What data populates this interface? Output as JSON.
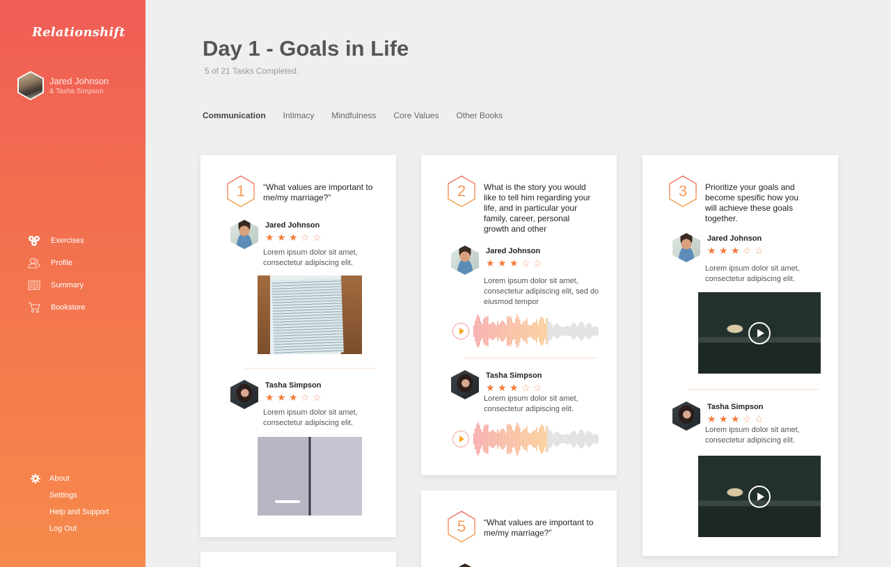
{
  "sidebar": {
    "logo": "Relationshift",
    "user": {
      "name": "Jared Johnson",
      "partner": "& Tasha Simpson"
    },
    "nav": [
      {
        "label": "Exercises",
        "icon": "exercises-icon"
      },
      {
        "label": "Profile",
        "icon": "profile-icon"
      },
      {
        "label": "Summary",
        "icon": "summary-icon"
      },
      {
        "label": "Bookstore",
        "icon": "cart-icon"
      }
    ],
    "bottom": [
      {
        "label": "About",
        "icon": "gear-icon"
      },
      {
        "label": "Settings"
      },
      {
        "label": "Help and Support"
      },
      {
        "label": "Log Out"
      }
    ]
  },
  "header": {
    "title": "Day 1 - Goals in Life",
    "subtitle": "5 of 21 Tasks Completed."
  },
  "tabs": [
    {
      "label": "Communication",
      "active": true
    },
    {
      "label": "Intimacy"
    },
    {
      "label": "Mindfulness"
    },
    {
      "label": "Core Values"
    },
    {
      "label": "Other Books"
    }
  ],
  "colors": {
    "accent": "#f47a3a",
    "sidebar_top": "#f05d56",
    "sidebar_bottom": "#f78a4b"
  },
  "cards": [
    {
      "number": "1",
      "question": "“What values are important to me/my marriage?”",
      "answers": [
        {
          "name": "Jared Johnson",
          "rating": 3,
          "max": 5,
          "text": "Lorem ipsum dolor sit amet, consectetur adipiscing elit.",
          "media": "photo-handwritten-note"
        },
        {
          "name": "Tasha Simpson",
          "rating": 3,
          "max": 5,
          "text": "Lorem ipsum dolor sit amet, consectetur adipiscing elit.",
          "media": "photo-notebook"
        }
      ]
    },
    {
      "number": "2",
      "question": "What is the story you would like to tell him regarding your life, and in particular your family, career, personal growth and other",
      "answers": [
        {
          "name": "Jared Johnson",
          "rating": 3,
          "max": 5,
          "text": "Lorem ipsum dolor sit amet, consectetur adipiscing elit, sed do eiusmod tempor",
          "media": "audio",
          "progress": 0.58
        },
        {
          "name": "Tasha Simpson",
          "rating": 3,
          "max": 5,
          "text": "Lorem ipsum dolor sit amet, consectetur adipiscing elit.",
          "media": "audio",
          "progress": 0.58
        }
      ]
    },
    {
      "number": "3",
      "question": "Prioritize your goals and become spesific how you will achieve these goals together.",
      "answers": [
        {
          "name": "Jared Johnson",
          "rating": 3,
          "max": 5,
          "text": "Lorem ipsum dolor sit amet, consectetur adipiscing elit.",
          "media": "video"
        },
        {
          "name": "Tasha Simpson",
          "rating": 3,
          "max": 5,
          "text": "Lorem ipsum dolor sit amet, consectetur adipiscing elit.",
          "media": "video"
        }
      ]
    },
    {
      "number": "5",
      "question": "“What values are important to me/my marriage?”"
    }
  ]
}
